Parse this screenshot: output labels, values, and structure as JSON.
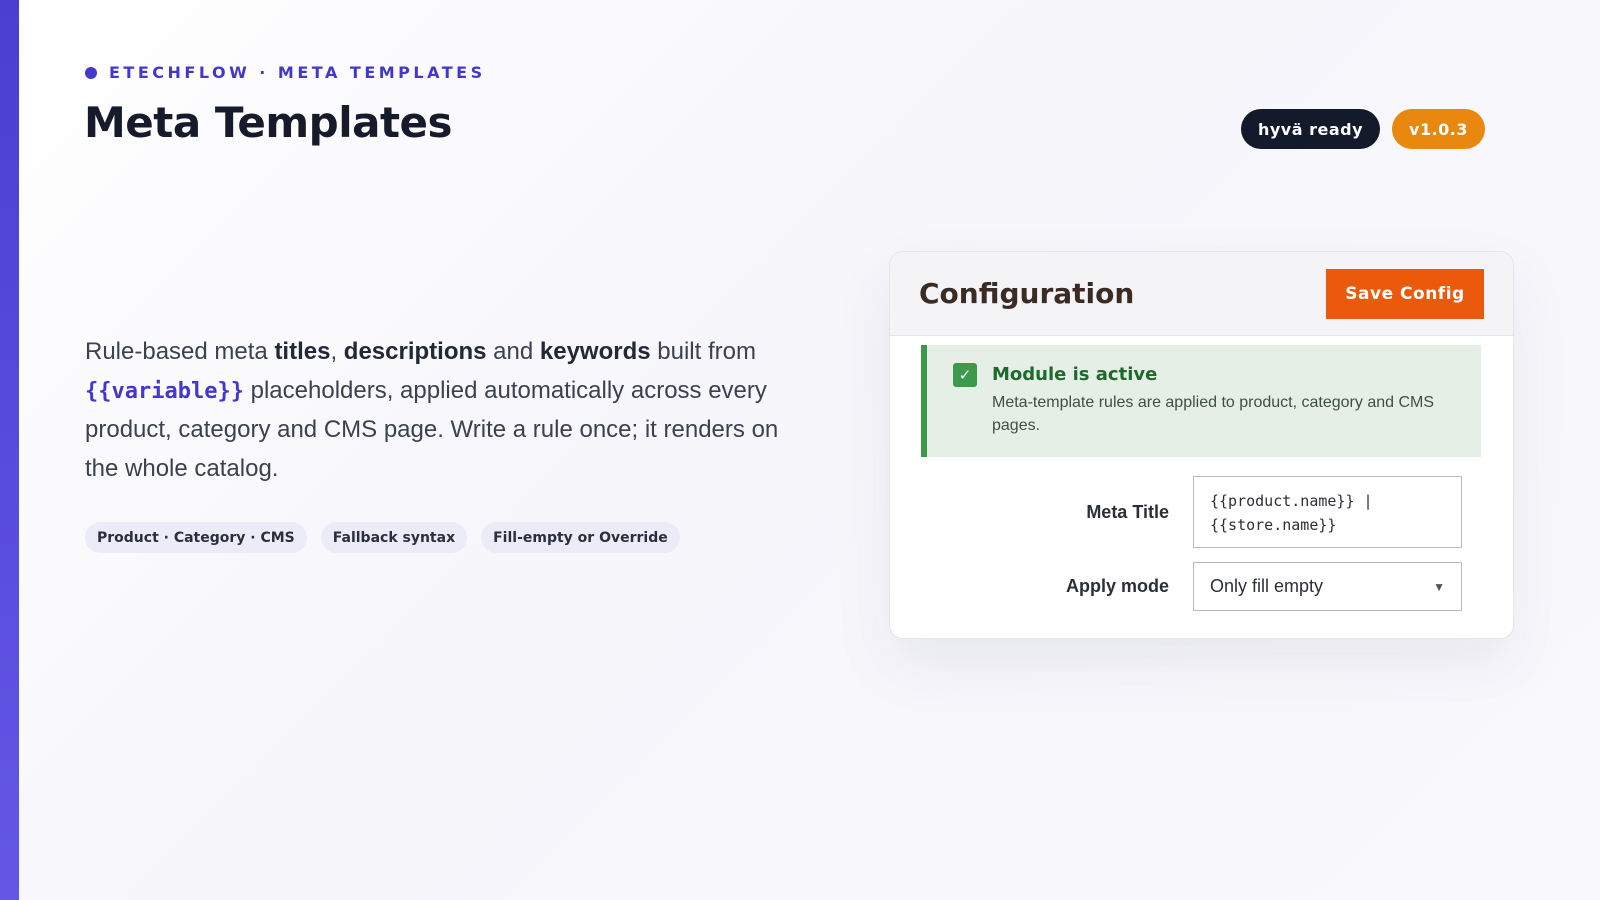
{
  "header": {
    "eyebrow": "ETECHFLOW · META TEMPLATES",
    "title": "Meta Templates",
    "badges": [
      "hyvä ready",
      "v1.0.3"
    ]
  },
  "lead": {
    "part1": "Rule-based meta ",
    "bold1": "titles",
    "part2": ", ",
    "bold2": "descriptions",
    "part3": " and ",
    "bold3": "keywords",
    "part4": " built from ",
    "code": "{{variable}}",
    "part5": " placeholders, applied automatically across every product, category and CMS page. Write a rule once; it renders on the whole catalog."
  },
  "chips": [
    "Product · Category · CMS",
    "Fallback syntax",
    "Fill-empty or Override"
  ],
  "card": {
    "title": "Configuration",
    "save_label": "Save Config",
    "notice": {
      "title": "Module is active",
      "text": "Meta-template rules are applied to product, category and CMS pages."
    },
    "meta_title": {
      "label": "Meta Title",
      "value": "{{product.name}} | {{store.name}}"
    },
    "apply_mode": {
      "label": "Apply mode",
      "value": "Only fill empty"
    }
  },
  "colors": {
    "accent": "#4338ca",
    "save_button": "#eb5a0c",
    "version_badge": "#e8880e",
    "success": "#3f9748"
  }
}
